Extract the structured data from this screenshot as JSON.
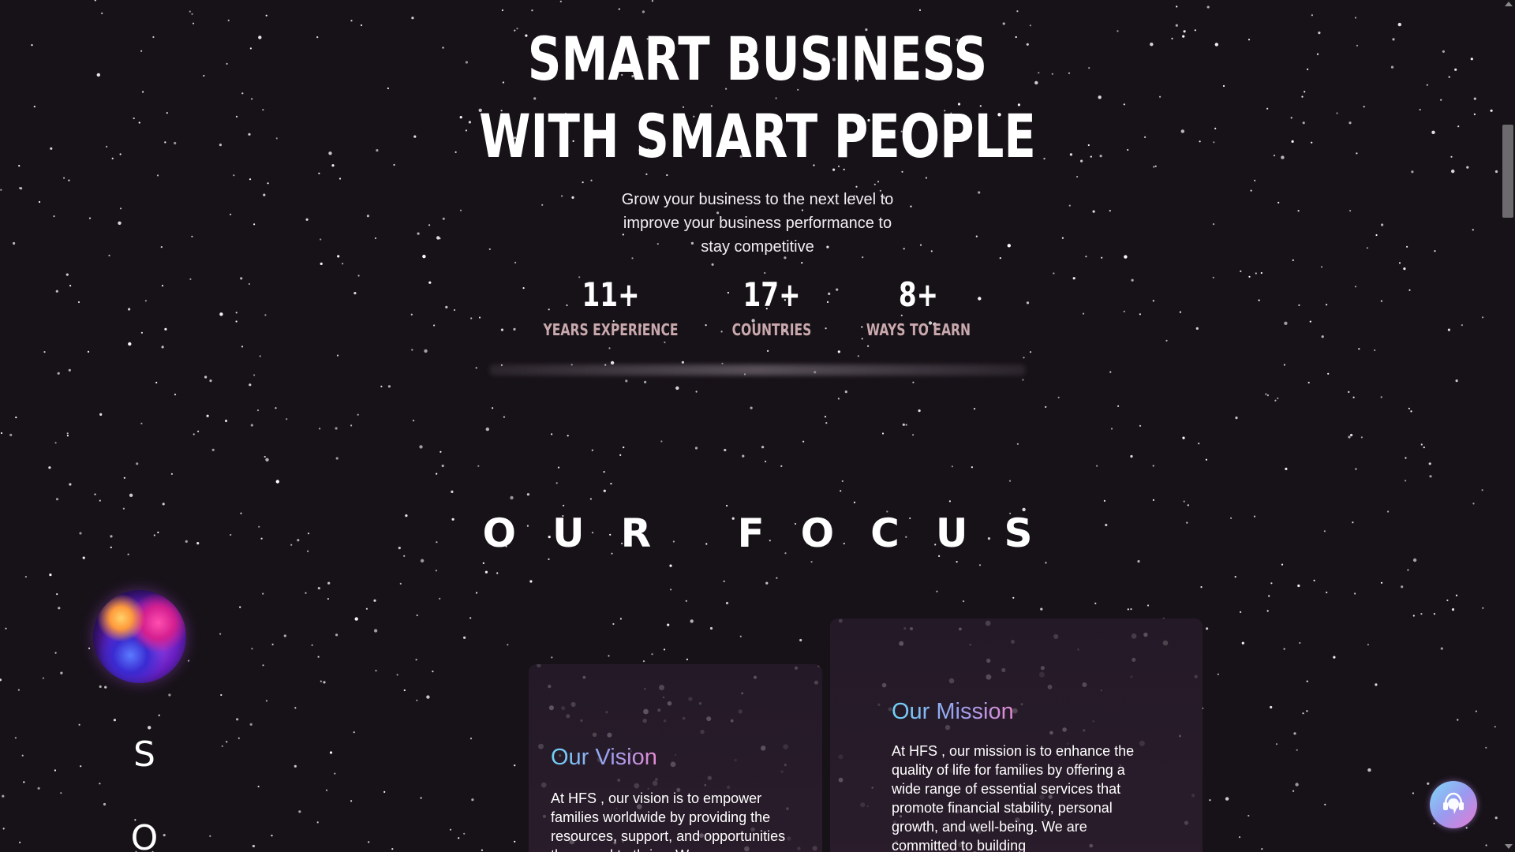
{
  "hero": {
    "title_line1": "SMART BUSINESS",
    "title_line2": "WITH SMART PEOPLE",
    "subtitle": "Grow your business to the next level to improve your business performance to stay competitive"
  },
  "stats": [
    {
      "value": "11+",
      "label": "YEARS EXPERIENCE"
    },
    {
      "value": "17+",
      "label": "COUNTRIES"
    },
    {
      "value": "8+",
      "label": "WAYS TO EARN"
    }
  ],
  "focus": {
    "title": "OUR FOCUS",
    "side_letters": [
      "S",
      "O"
    ],
    "vision": {
      "title": "Our Vision",
      "text": "At HFS , our vision is to empower families worldwide by providing the resources, support, and opportunities they need to thrive. We"
    },
    "mission": {
      "title": "Our Mission",
      "text": "At HFS , our mission is to enhance the quality of life for families by offering a wide range of essential services that promote financial stability, personal growth, and well-being. We are committed to building"
    }
  },
  "widgets": {
    "chat_icon": "headset-chat-icon",
    "orb_icon": "iridescent-orb-icon"
  },
  "colors": {
    "background": "#171218",
    "card_background": "#241a27",
    "stat_label": "#c9a9ad",
    "title_gradient_start": "#6fd3f7",
    "title_gradient_end": "#e58ad0"
  }
}
